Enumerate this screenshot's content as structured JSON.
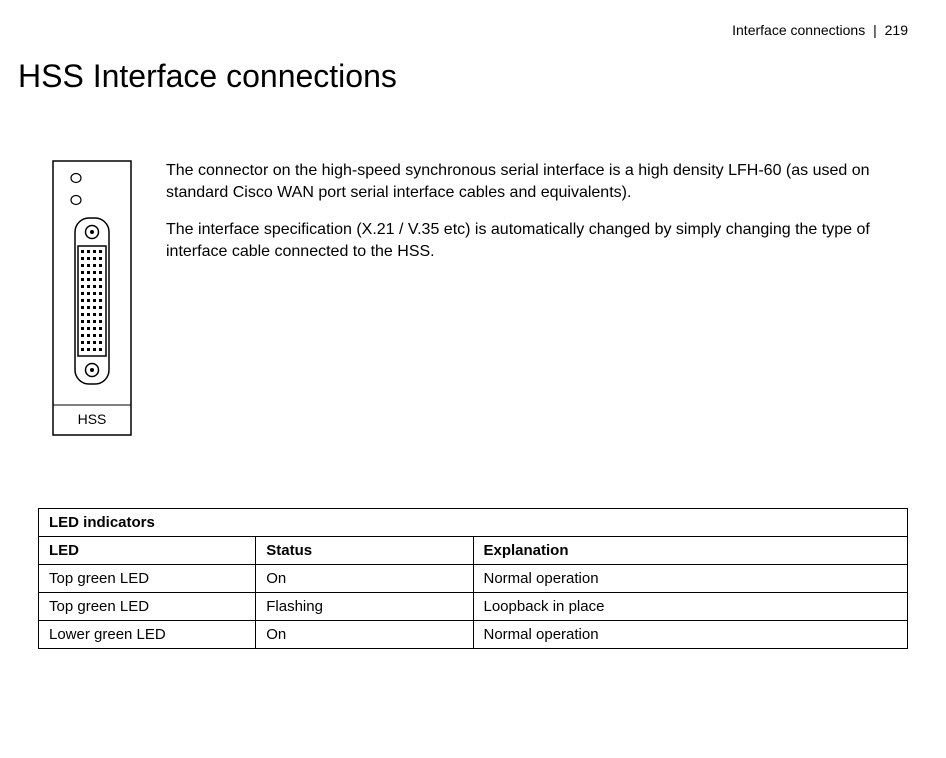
{
  "header": {
    "section": "Interface connections",
    "divider": "|",
    "page": "219"
  },
  "title": "HSS Interface connections",
  "paragraphs": [
    "The connector on the high-speed synchronous serial interface is a high density LFH-60 (as used on standard Cisco WAN port serial interface cables and equivalents).",
    "The interface specification (X.21 / V.35 etc) is automatically changed by simply changing the type of interface cable connected to the HSS."
  ],
  "panel_label": "HSS",
  "table": {
    "caption": "LED indicators",
    "columns": [
      "LED",
      "Status",
      "Explanation"
    ],
    "rows": [
      [
        "Top green LED",
        "On",
        "Normal operation"
      ],
      [
        "Top green LED",
        "Flashing",
        "Loopback in place"
      ],
      [
        "Lower green LED",
        "On",
        "Normal operation"
      ]
    ]
  }
}
